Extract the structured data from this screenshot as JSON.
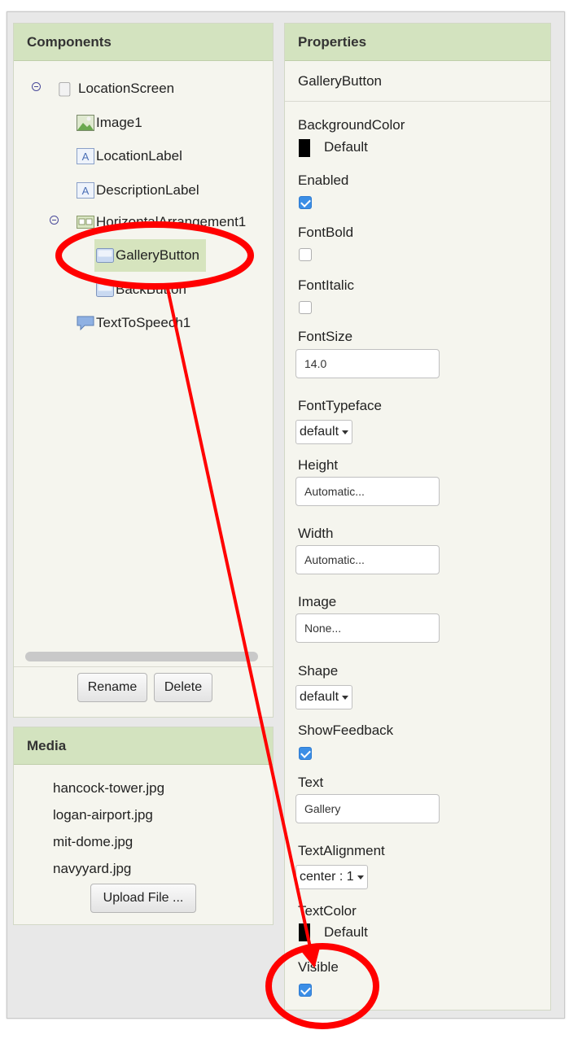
{
  "components": {
    "header": "Components",
    "tree": [
      {
        "label": "LocationScreen",
        "icon": "screen-icon"
      },
      {
        "label": "Image1",
        "icon": "image-icon"
      },
      {
        "label": "LocationLabel",
        "icon": "label-icon"
      },
      {
        "label": "DescriptionLabel",
        "icon": "label-icon"
      },
      {
        "label": "HorizontalArrangement1",
        "icon": "arrangement-icon"
      },
      {
        "label": "GalleryButton",
        "icon": "button-icon",
        "selected": true
      },
      {
        "label": "BackButton",
        "icon": "button-icon"
      },
      {
        "label": "TextToSpeech1",
        "icon": "speech-icon"
      }
    ],
    "rename_label": "Rename",
    "delete_label": "Delete"
  },
  "media": {
    "header": "Media",
    "files": [
      "hancock-tower.jpg",
      "logan-airport.jpg",
      "mit-dome.jpg",
      "navyyard.jpg"
    ],
    "upload_label": "Upload File ..."
  },
  "properties": {
    "header": "Properties",
    "component_name": "GalleryButton",
    "background_color": {
      "label": "BackgroundColor",
      "value": "Default",
      "swatch": "#000000"
    },
    "enabled": {
      "label": "Enabled",
      "checked": true
    },
    "font_bold": {
      "label": "FontBold",
      "checked": false
    },
    "font_italic": {
      "label": "FontItalic",
      "checked": false
    },
    "font_size": {
      "label": "FontSize",
      "value": "14.0"
    },
    "font_typeface": {
      "label": "FontTypeface",
      "value": "default"
    },
    "height": {
      "label": "Height",
      "value": "Automatic..."
    },
    "width": {
      "label": "Width",
      "value": "Automatic..."
    },
    "image": {
      "label": "Image",
      "value": "None..."
    },
    "shape": {
      "label": "Shape",
      "value": "default"
    },
    "show_feedback": {
      "label": "ShowFeedback",
      "checked": true
    },
    "text": {
      "label": "Text",
      "value": "Gallery"
    },
    "text_alignment": {
      "label": "TextAlignment",
      "value": "center : 1"
    },
    "text_color": {
      "label": "TextColor",
      "value": "Default",
      "swatch": "#000000"
    },
    "visible": {
      "label": "Visible",
      "checked": true
    }
  },
  "annotation": {
    "color": "#ff0000"
  }
}
